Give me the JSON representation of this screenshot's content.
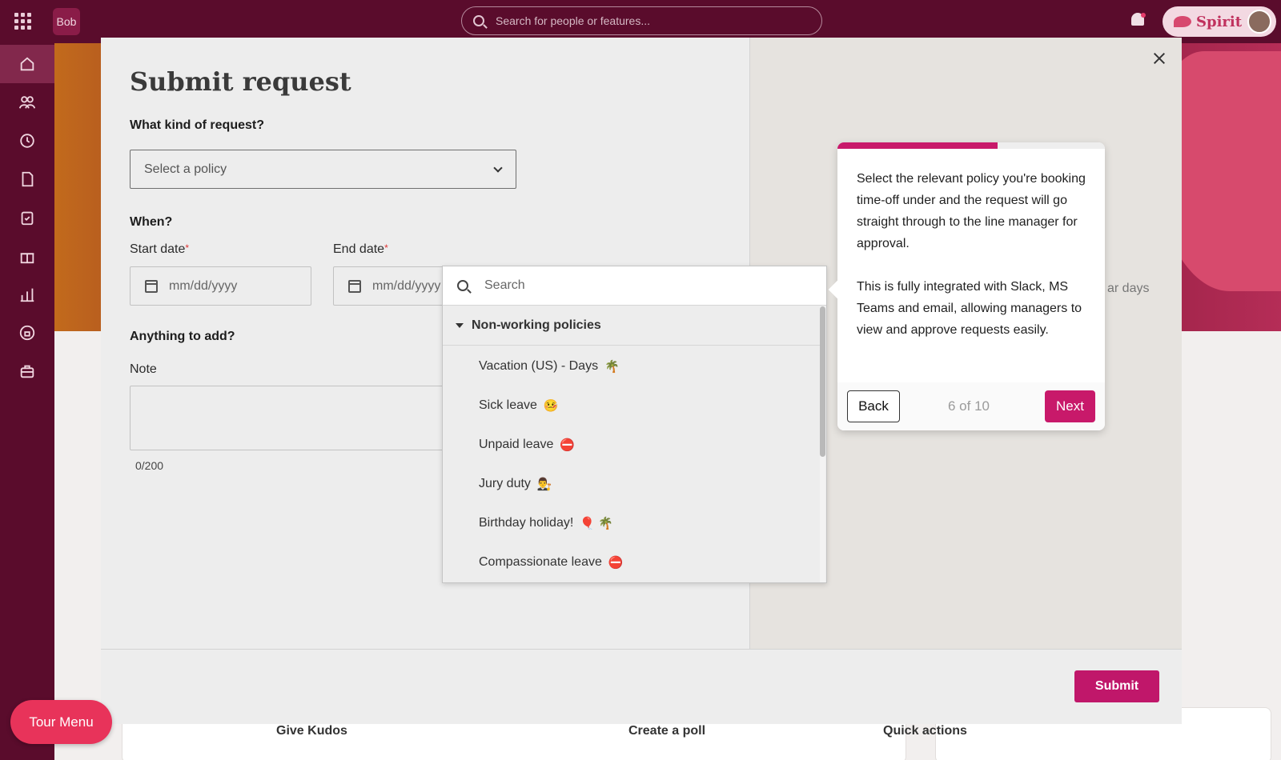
{
  "app": {
    "logo": "Bob"
  },
  "topbar": {
    "search_placeholder": "Search for people or features...",
    "spirit_label": "Spirit"
  },
  "sidebar": {
    "items": [
      {
        "name": "home-icon"
      },
      {
        "name": "people-icon"
      },
      {
        "name": "clock-icon"
      },
      {
        "name": "document-icon"
      },
      {
        "name": "clipboard-icon"
      },
      {
        "name": "gift-icon"
      },
      {
        "name": "chart-icon"
      },
      {
        "name": "lock-icon"
      },
      {
        "name": "briefcase-icon"
      }
    ]
  },
  "modal": {
    "title": "Submit request",
    "kind_question": "What kind of request?",
    "policy_placeholder": "Select a policy",
    "when_question": "When?",
    "start_label": "Start date",
    "end_label": "End date",
    "required_mark": "*",
    "date_placeholder": "mm/dd/yyyy",
    "add_question": "Anything to add?",
    "note_label": "Note",
    "note_counter": "0/200",
    "submit_label": "Submit",
    "right_text": "ar days"
  },
  "dropdown": {
    "search_placeholder": "Search",
    "group_label": "Non-working policies",
    "items": [
      {
        "label": "Vacation (US) - Days",
        "emoji": "🌴"
      },
      {
        "label": "Sick leave",
        "emoji": "🤒"
      },
      {
        "label": "Unpaid leave",
        "emoji": "⛔"
      },
      {
        "label": "Jury duty",
        "emoji": "👨‍⚖️"
      },
      {
        "label": "Birthday holiday!",
        "emoji": "🎈 🌴"
      },
      {
        "label": "Compassionate leave",
        "emoji": "⛔"
      }
    ]
  },
  "tour": {
    "paragraph1": "Select the relevant policy you're booking time-off under and the request will go straight through to the line manager for approval.",
    "paragraph2": "This is fully integrated with Slack, MS Teams and email, allowing managers to view and approve requests easily.",
    "back_label": "Back",
    "step_text": "6 of 10",
    "next_label": "Next",
    "progress": 0.6,
    "accent": "#c8196a"
  },
  "tour_menu_label": "Tour Menu",
  "background": {
    "give_kudos": "Give Kudos",
    "create_poll": "Create a poll",
    "quick_actions": "Quick actions"
  }
}
